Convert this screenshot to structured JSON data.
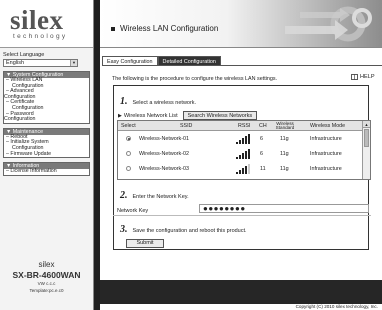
{
  "sidebar": {
    "logo_main": "silex",
    "logo_sub": "technology",
    "language": {
      "label": "Select Language",
      "value": "English"
    },
    "menus": [
      {
        "title": "▼ System Configuration",
        "items": [
          "– Wireless LAN",
          "  Configuration",
          "– Advanced",
          "Configuration",
          "– Certificate",
          "  Configuration",
          "– Password",
          "Configuration"
        ]
      },
      {
        "title": "▼ Maintenance",
        "items": [
          "– Reboot",
          "– Initialize System",
          "  Configuration",
          "– Firmware Update"
        ]
      },
      {
        "title": "▼ Information",
        "items": [
          "– License Information"
        ]
      }
    ],
    "brand": "silex",
    "model": "SX-BR-4600WAN",
    "version_lines": [
      "VW c.c.c",
      "Template:pc.e.c0"
    ]
  },
  "header": {
    "title": "Wireless LAN Configuration"
  },
  "tabs": [
    {
      "label": "Easy Configuration",
      "active": true
    },
    {
      "label": "Detailed Configuration",
      "active": false
    }
  ],
  "intro": "The following is the procedure to configure the wireless LAN settings.",
  "help_label": "HELP",
  "step1": {
    "num": "1.",
    "text": "Select a wireless network."
  },
  "network_list_label": "Wireless Network List",
  "search_button": "Search Wireless Networks",
  "grid": {
    "headers": {
      "select": "Select",
      "ssid": "SSID",
      "rssi": "RSSI",
      "ch": "CH",
      "standard": "Wireless Standard",
      "mode": "Wireless Mode"
    },
    "rows": [
      {
        "ssid": "Wireless-Network-01",
        "rssi": 5,
        "ch": "6",
        "standard": "11g",
        "mode": "Infrastructure",
        "selected": true
      },
      {
        "ssid": "Wireless-Network-02",
        "rssi": 5,
        "ch": "6",
        "standard": "11g",
        "mode": "Infrastructure",
        "selected": false
      },
      {
        "ssid": "Wireless-Network-03",
        "rssi": 4,
        "ch": "11",
        "standard": "11g",
        "mode": "Infrastructure",
        "selected": false
      }
    ]
  },
  "step2": {
    "num": "2.",
    "text": "Enter the Network Key."
  },
  "network_key": {
    "label": "Network Key",
    "value": "●●●●●●●●"
  },
  "step3": {
    "num": "3.",
    "text": "Save the configuration and reboot this product."
  },
  "submit_label": "Submit",
  "footer": {
    "copyright": "Copyright (C) 2010 silex technology, Inc."
  }
}
